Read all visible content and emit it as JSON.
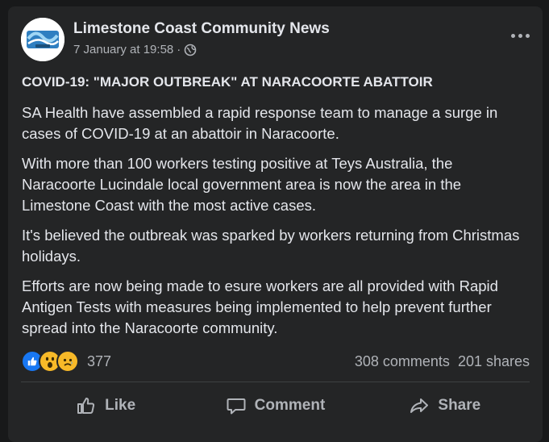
{
  "post": {
    "page_name": "Limestone Coast Community News",
    "avatar_text": "Limestone Coast",
    "timestamp": "7 January at 19:58",
    "separator": "·",
    "privacy_icon": "globe-icon",
    "more_icon": "ellipsis-icon",
    "title": "COVID-19: \"MAJOR OUTBREAK\" AT NARACOORTE ABATTOIR",
    "paragraphs": [
      "SA Health have assembled a rapid response team to manage a surge in cases of COVID-19 at an abattoir in Naracoorte.",
      "With more than 100 workers testing positive at Teys Australia, the Naracoorte Lucindale local government area is now the area in the Limestone Coast with the most active cases.",
      "It's believed the outbreak was sparked by workers returning from Christmas holidays.",
      "Efforts are now being made to esure workers are all provided with Rapid Antigen Tests with measures being implemented to help prevent further spread into the Naracoorte community."
    ]
  },
  "stats": {
    "reactions": [
      "like-icon",
      "wow-icon",
      "sad-icon"
    ],
    "reaction_count": "377",
    "comments": "308 comments",
    "shares": "201 shares"
  },
  "actions": {
    "like": "Like",
    "comment": "Comment",
    "share": "Share"
  },
  "colors": {
    "background": "#18191a",
    "card": "#242526",
    "text_primary": "#e4e6eb",
    "text_secondary": "#b0b3b8",
    "like_blue": "#1877f2",
    "reaction_yellow": "#f7b928"
  }
}
